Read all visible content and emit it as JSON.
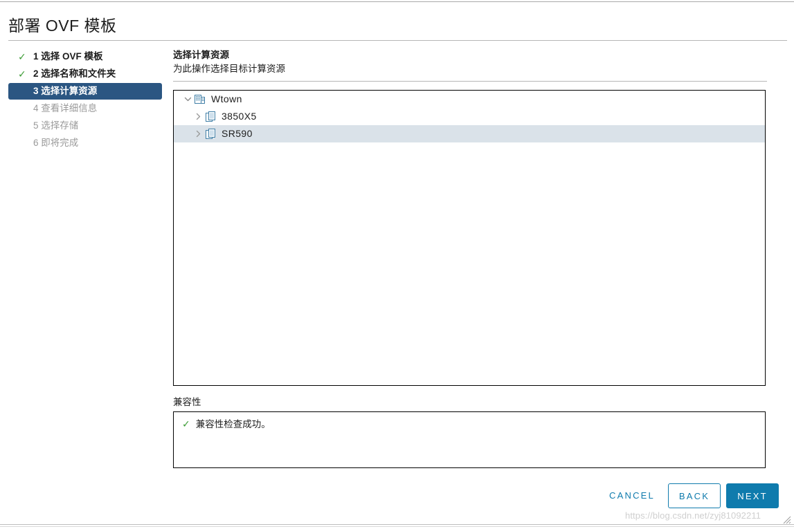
{
  "window": {
    "title": "部署 OVF 模板"
  },
  "steps": [
    {
      "num": "1",
      "label": "1 选择 OVF 模板",
      "state": "done",
      "icon": "check-icon"
    },
    {
      "num": "2",
      "label": "2 选择名称和文件夹",
      "state": "done",
      "icon": "check-icon"
    },
    {
      "num": "3",
      "label": "3 选择计算资源",
      "state": "active",
      "icon": ""
    },
    {
      "num": "4",
      "label": "4 查看详细信息",
      "state": "pending",
      "icon": ""
    },
    {
      "num": "5",
      "label": "5 选择存储",
      "state": "pending",
      "icon": ""
    },
    {
      "num": "6",
      "label": "6 即将完成",
      "state": "pending",
      "icon": ""
    }
  ],
  "pane": {
    "title": "选择计算资源",
    "subtitle": "为此操作选择目标计算资源"
  },
  "tree": [
    {
      "label": "Wtown",
      "level": 0,
      "icon": "datacenter-icon",
      "twisty": "chevron-down-icon",
      "expanded": true,
      "selected": false
    },
    {
      "label": "3850X5",
      "level": 1,
      "icon": "cluster-icon",
      "twisty": "chevron-right-icon",
      "expanded": false,
      "selected": false
    },
    {
      "label": "SR590",
      "level": 1,
      "icon": "cluster-icon",
      "twisty": "chevron-right-icon",
      "expanded": false,
      "selected": true
    }
  ],
  "compatibility": {
    "label": "兼容性",
    "status_icon": "check-icon",
    "message": "兼容性检查成功。"
  },
  "footer": {
    "cancel_label": "CANCEL",
    "back_label": "BACK",
    "next_label": "NEXT"
  },
  "watermark": {
    "text": "https://blog.csdn.net/zyj81092211"
  },
  "colors": {
    "accent_blue": "#0f7bad",
    "active_step_bg": "#2b5682",
    "success_green": "#3c9c35",
    "selected_row": "#dae2e9",
    "icon_blue": "#3f7ea6"
  }
}
